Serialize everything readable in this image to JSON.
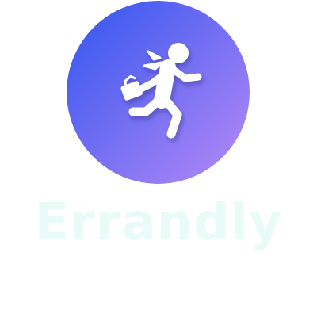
{
  "brand": {
    "name": "Errandly",
    "name_color": "#e8fbf6"
  },
  "logo": {
    "icon": "running-businessman-icon",
    "gradient_start": "#3a5cf0",
    "gradient_end": "#b88af7",
    "figure_color": "#ffffff"
  }
}
